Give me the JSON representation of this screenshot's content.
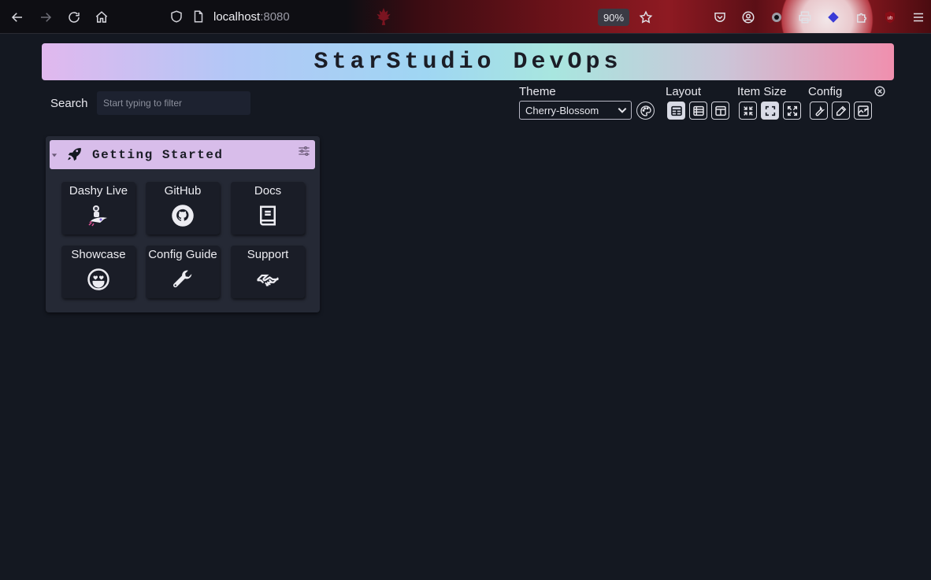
{
  "browser": {
    "url_host": "localhost",
    "url_port": ":8080",
    "zoom": "90%"
  },
  "page": {
    "title": "StarStudio DevOps"
  },
  "search": {
    "label": "Search",
    "placeholder": "Start typing to filter"
  },
  "settings": {
    "theme_label": "Theme",
    "theme_value": "Cherry-Blossom",
    "layout_label": "Layout",
    "item_size_label": "Item Size",
    "config_label": "Config",
    "item_size_active": "medium"
  },
  "sections": [
    {
      "title": "Getting Started",
      "icon": "rocket-icon",
      "items": [
        {
          "label": "Dashy Live",
          "icon": "astronaut-rocket-icon"
        },
        {
          "label": "GitHub",
          "icon": "github-icon"
        },
        {
          "label": "Docs",
          "icon": "book-icon"
        },
        {
          "label": "Showcase",
          "icon": "heart-eyes-icon"
        },
        {
          "label": "Config Guide",
          "icon": "wrench-icon"
        },
        {
          "label": "Support",
          "icon": "handshake-icon"
        }
      ]
    }
  ],
  "colors": {
    "background": "#141821",
    "section_bg": "#252935",
    "section_header": "#d8bdea",
    "tile_bg": "#1a1d27"
  }
}
